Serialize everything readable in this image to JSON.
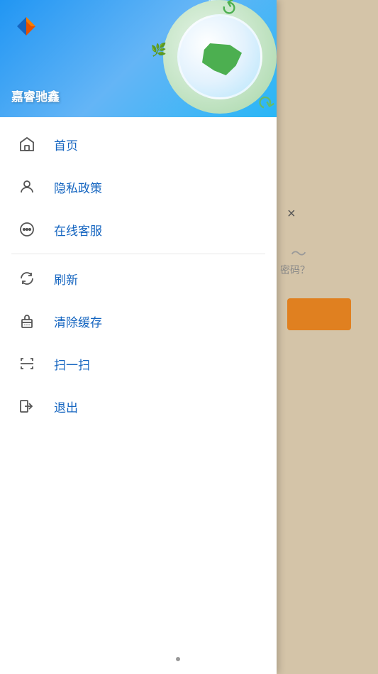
{
  "app": {
    "title": "嘉睿驰鑫"
  },
  "header": {
    "company_name": "嘉睿驰鑫"
  },
  "menu": {
    "group1": [
      {
        "id": "home",
        "label": "首页",
        "icon": "home"
      },
      {
        "id": "privacy",
        "label": "隐私政策",
        "icon": "person"
      },
      {
        "id": "service",
        "label": "在线客服",
        "icon": "chat"
      }
    ],
    "group2": [
      {
        "id": "refresh",
        "label": "刷新",
        "icon": "refresh"
      },
      {
        "id": "clear-cache",
        "label": "清除缓存",
        "icon": "cache"
      },
      {
        "id": "scan",
        "label": "扫一扫",
        "icon": "scan"
      },
      {
        "id": "logout",
        "label": "退出",
        "icon": "logout"
      }
    ]
  },
  "right_panel": {
    "close_label": "×",
    "password_hint": "密码？",
    "eye_icon": "👁"
  },
  "bottom_dot": "•"
}
